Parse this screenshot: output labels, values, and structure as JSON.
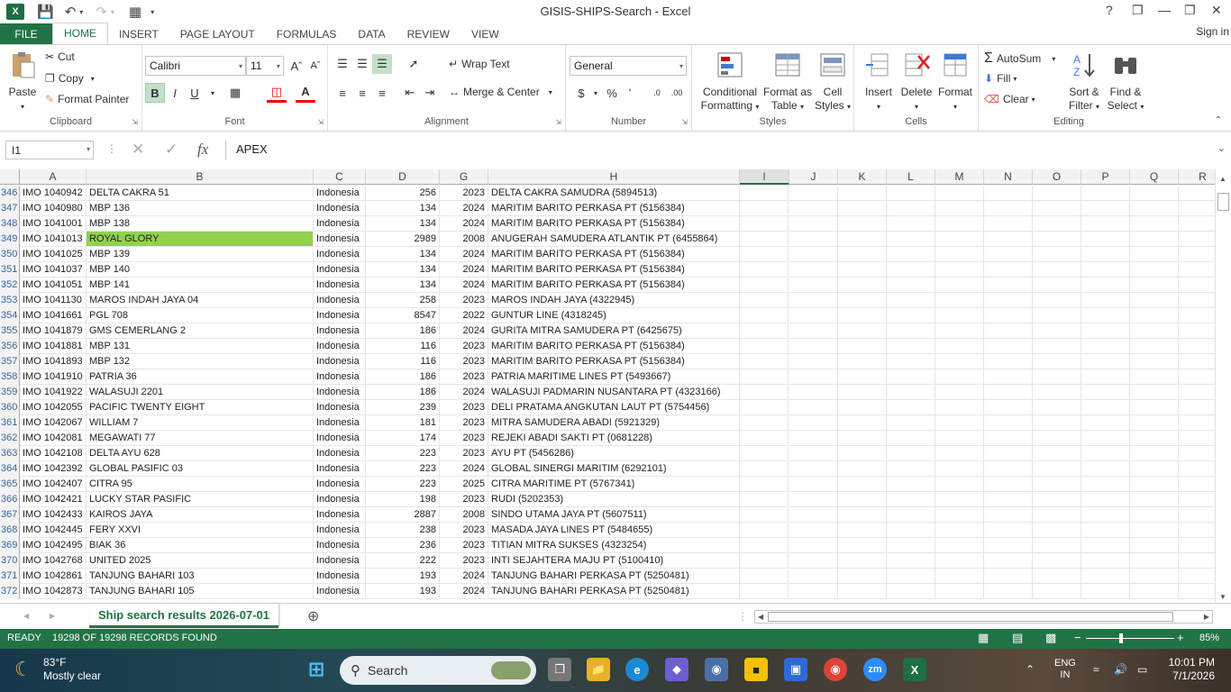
{
  "window": {
    "title": "GISIS-SHIPS-Search - Excel",
    "app_logo": "X",
    "signin": "Sign in",
    "controls": {
      "help": "?",
      "ribbon_display": "❐",
      "minimize": "—",
      "restore": "❐",
      "close": "✕"
    }
  },
  "ribbon": {
    "tabs": [
      "FILE",
      "HOME",
      "INSERT",
      "PAGE LAYOUT",
      "FORMULAS",
      "DATA",
      "REVIEW",
      "VIEW"
    ],
    "active_tab": "HOME",
    "clipboard": {
      "paste": "Paste",
      "cut": "Cut",
      "copy": "Copy",
      "format_painter": "Format Painter",
      "label": "Clipboard"
    },
    "font": {
      "name": "Calibri",
      "size": "11",
      "bold": "B",
      "italic": "I",
      "underline": "U",
      "label": "Font",
      "grow": "Aˆ",
      "shrink": "Aˇ"
    },
    "alignment": {
      "wrap_text": "Wrap Text",
      "merge_center": "Merge & Center",
      "label": "Alignment"
    },
    "number": {
      "format": "General",
      "currency": "$",
      "percent": "%",
      "comma": "ʼ",
      "label": "Number"
    },
    "styles": {
      "conditional_1": "Conditional",
      "conditional_2": "Formatting",
      "format_table_1": "Format as",
      "format_table_2": "Table",
      "cell_styles_1": "Cell",
      "cell_styles_2": "Styles",
      "label": "Styles"
    },
    "cells": {
      "insert": "Insert",
      "delete": "Delete",
      "format": "Format",
      "label": "Cells"
    },
    "editing": {
      "autosum": "AutoSum",
      "fill": "Fill",
      "clear": "Clear",
      "sort_1": "Sort &",
      "sort_2": "Filter",
      "find_1": "Find &",
      "find_2": "Select",
      "label": "Editing"
    }
  },
  "formula_bar": {
    "name_box": "I1",
    "fx": "fx",
    "value": "APEX"
  },
  "columns": [
    "A",
    "B",
    "C",
    "D",
    "G",
    "H",
    "I",
    "J",
    "K",
    "L",
    "M",
    "N",
    "O",
    "P",
    "Q",
    "R"
  ],
  "selected_column": "I",
  "rows": [
    {
      "n": "346",
      "a": "IMO 1040942",
      "b": "DELTA CAKRA 51",
      "c": "Indonesia",
      "d": "256",
      "g": "2023",
      "h": "DELTA CAKRA SAMUDRA (5894513)"
    },
    {
      "n": "347",
      "a": "IMO 1040980",
      "b": "MBP 136",
      "c": "Indonesia",
      "d": "134",
      "g": "2024",
      "h": "MARITIM BARITO PERKASA PT (5156384)"
    },
    {
      "n": "348",
      "a": "IMO 1041001",
      "b": "MBP 138",
      "c": "Indonesia",
      "d": "134",
      "g": "2024",
      "h": "MARITIM BARITO PERKASA PT (5156384)"
    },
    {
      "n": "349",
      "a": "IMO 1041013",
      "b": "ROYAL GLORY",
      "c": "Indonesia",
      "d": "2989",
      "g": "2008",
      "h": "ANUGERAH SAMUDERA ATLANTIK PT (6455864)",
      "highlight": true
    },
    {
      "n": "350",
      "a": "IMO 1041025",
      "b": "MBP 139",
      "c": "Indonesia",
      "d": "134",
      "g": "2024",
      "h": "MARITIM BARITO PERKASA PT (5156384)"
    },
    {
      "n": "351",
      "a": "IMO 1041037",
      "b": "MBP 140",
      "c": "Indonesia",
      "d": "134",
      "g": "2024",
      "h": "MARITIM BARITO PERKASA PT (5156384)"
    },
    {
      "n": "352",
      "a": "IMO 1041051",
      "b": "MBP 141",
      "c": "Indonesia",
      "d": "134",
      "g": "2024",
      "h": "MARITIM BARITO PERKASA PT (5156384)"
    },
    {
      "n": "353",
      "a": "IMO 1041130",
      "b": "MAROS INDAH JAYA 04",
      "c": "Indonesia",
      "d": "258",
      "g": "2023",
      "h": "MAROS INDAH JAYA (4322945)"
    },
    {
      "n": "354",
      "a": "IMO 1041661",
      "b": "PGL 708",
      "c": "Indonesia",
      "d": "8547",
      "g": "2022",
      "h": "GUNTUR LINE (4318245)"
    },
    {
      "n": "355",
      "a": "IMO 1041879",
      "b": "GMS CEMERLANG 2",
      "c": "Indonesia",
      "d": "186",
      "g": "2024",
      "h": "GURITA MITRA SAMUDERA PT (6425675)"
    },
    {
      "n": "356",
      "a": "IMO 1041881",
      "b": "MBP 131",
      "c": "Indonesia",
      "d": "116",
      "g": "2023",
      "h": "MARITIM BARITO PERKASA PT (5156384)"
    },
    {
      "n": "357",
      "a": "IMO 1041893",
      "b": "MBP 132",
      "c": "Indonesia",
      "d": "116",
      "g": "2023",
      "h": "MARITIM BARITO PERKASA PT (5156384)"
    },
    {
      "n": "358",
      "a": "IMO 1041910",
      "b": "PATRIA 36",
      "c": "Indonesia",
      "d": "186",
      "g": "2023",
      "h": "PATRIA MARITIME LINES PT (5493667)"
    },
    {
      "n": "359",
      "a": "IMO 1041922",
      "b": "WALASUJI 2201",
      "c": "Indonesia",
      "d": "186",
      "g": "2024",
      "h": "WALASUJI PADMARIN NUSANTARA PT (4323166)"
    },
    {
      "n": "360",
      "a": "IMO 1042055",
      "b": "PACIFIC TWENTY EIGHT",
      "c": "Indonesia",
      "d": "239",
      "g": "2023",
      "h": "DELI PRATAMA ANGKUTAN LAUT PT (5754456)"
    },
    {
      "n": "361",
      "a": "IMO 1042067",
      "b": "WILLIAM 7",
      "c": "Indonesia",
      "d": "181",
      "g": "2023",
      "h": "MITRA SAMUDERA ABADI (5921329)"
    },
    {
      "n": "362",
      "a": "IMO 1042081",
      "b": "MEGAWATI 77",
      "c": "Indonesia",
      "d": "174",
      "g": "2023",
      "h": "REJEKI ABADI SAKTI PT (0681228)"
    },
    {
      "n": "363",
      "a": "IMO 1042108",
      "b": "DELTA AYU 628",
      "c": "Indonesia",
      "d": "223",
      "g": "2023",
      "h": "AYU PT (5456286)"
    },
    {
      "n": "364",
      "a": "IMO 1042392",
      "b": "GLOBAL PASIFIC 03",
      "c": "Indonesia",
      "d": "223",
      "g": "2024",
      "h": "GLOBAL SINERGI MARITIM (6292101)"
    },
    {
      "n": "365",
      "a": "IMO 1042407",
      "b": "CITRA 95",
      "c": "Indonesia",
      "d": "223",
      "g": "2025",
      "h": "CITRA MARITIME PT (5767341)"
    },
    {
      "n": "366",
      "a": "IMO 1042421",
      "b": "LUCKY STAR PASIFIC",
      "c": "Indonesia",
      "d": "198",
      "g": "2023",
      "h": "RUDI (5202353)"
    },
    {
      "n": "367",
      "a": "IMO 1042433",
      "b": "KAIROS JAYA",
      "c": "Indonesia",
      "d": "2887",
      "g": "2008",
      "h": "SINDO UTAMA JAYA PT (5607511)"
    },
    {
      "n": "368",
      "a": "IMO 1042445",
      "b": "FERY XXVI",
      "c": "Indonesia",
      "d": "238",
      "g": "2023",
      "h": "MASADA JAYA LINES PT (5484655)"
    },
    {
      "n": "369",
      "a": "IMO 1042495",
      "b": "BIAK 36",
      "c": "Indonesia",
      "d": "236",
      "g": "2023",
      "h": "TITIAN MITRA SUKSES (4323254)"
    },
    {
      "n": "370",
      "a": "IMO 1042768",
      "b": "UNITED 2025",
      "c": "Indonesia",
      "d": "222",
      "g": "2023",
      "h": "INTI SEJAHTERA MAJU PT (5100410)"
    },
    {
      "n": "371",
      "a": "IMO 1042861",
      "b": "TANJUNG BAHARI 103",
      "c": "Indonesia",
      "d": "193",
      "g": "2024",
      "h": "TANJUNG BAHARI PERKASA PT (5250481)"
    },
    {
      "n": "372",
      "a": "IMO 1042873",
      "b": "TANJUNG BAHARI 105",
      "c": "Indonesia",
      "d": "193",
      "g": "2024",
      "h": "TANJUNG BAHARI PERKASA PT (5250481)"
    }
  ],
  "sheet_tab": "Ship search results 2026-07-01",
  "status": {
    "mode": "READY",
    "records": "19298 OF 19298 RECORDS FOUND",
    "zoom": "85%"
  },
  "taskbar": {
    "temperature": "83°F",
    "weather": "Mostly clear",
    "search_placeholder": "Search",
    "language_1": "ENG",
    "language_2": "IN",
    "time": "10:01 PM",
    "date": "7/1/2026"
  },
  "colors": {
    "excel_green": "#217346",
    "highlight": "#92d050",
    "status_bar": "#217346"
  }
}
